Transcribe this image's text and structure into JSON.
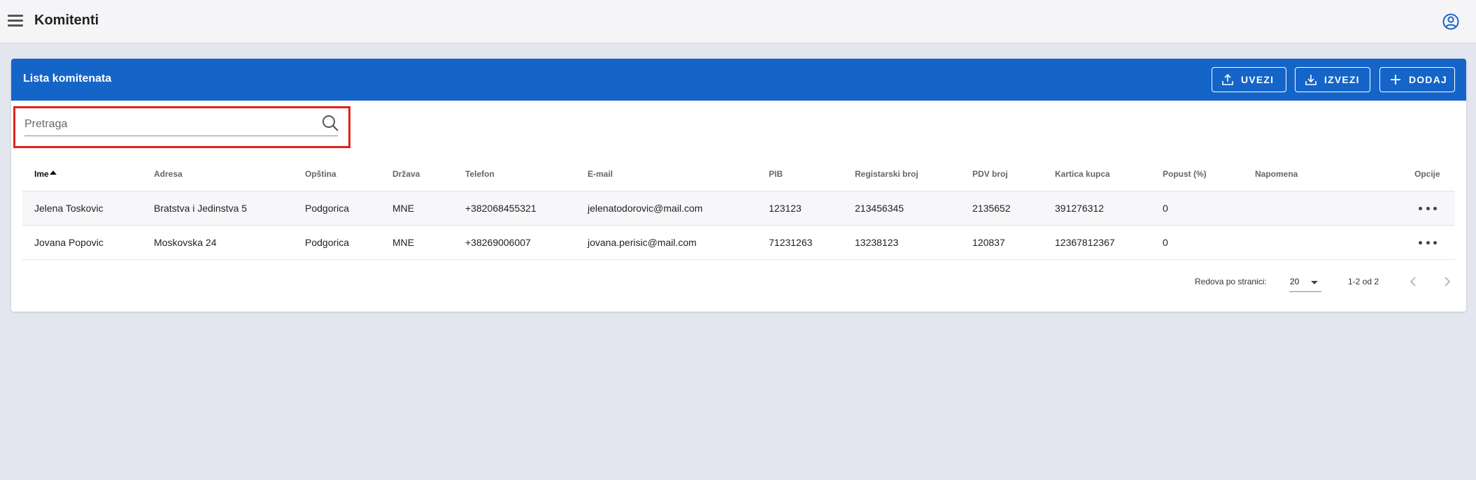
{
  "app": {
    "title": "Komitenti"
  },
  "card": {
    "title": "Lista komitenata",
    "buttons": {
      "import": "UVEZI",
      "export": "IZVEZI",
      "add": "DODAJ"
    }
  },
  "search": {
    "placeholder": "Pretraga",
    "value": ""
  },
  "table": {
    "columns": [
      "Ime",
      "Adresa",
      "Opština",
      "Država",
      "Telefon",
      "E-mail",
      "PIB",
      "Registarski broj",
      "PDV broj",
      "Kartica kupca",
      "Popust (%)",
      "Napomena",
      "Opcije"
    ],
    "rows": [
      {
        "ime": "Jelena Toskovic",
        "adresa": "Bratstva i Jedinstva 5",
        "opstina": "Podgorica",
        "drzava": "MNE",
        "telefon": "+382068455321",
        "email": "jelenatodorovic@mail.com",
        "pib": "123123",
        "registarski_broj": "213456345",
        "pdv_broj": "2135652",
        "kartica_kupca": "391276312",
        "popust": "0",
        "napomena": ""
      },
      {
        "ime": "Jovana Popovic",
        "adresa": "Moskovska 24",
        "opstina": "Podgorica",
        "drzava": "MNE",
        "telefon": "+38269006007",
        "email": "jovana.perisic@mail.com",
        "pib": "71231263",
        "registarski_broj": "13238123",
        "pdv_broj": "120837",
        "kartica_kupca": "12367812367",
        "popust": "0",
        "napomena": ""
      }
    ]
  },
  "pagination": {
    "rows_per_page_label": "Redova po stranici:",
    "rows_per_page": "20",
    "range": "1-2 od 2"
  },
  "colors": {
    "header": "#1565c8",
    "highlight": "#e0231b",
    "background": "#e3e6ef"
  }
}
